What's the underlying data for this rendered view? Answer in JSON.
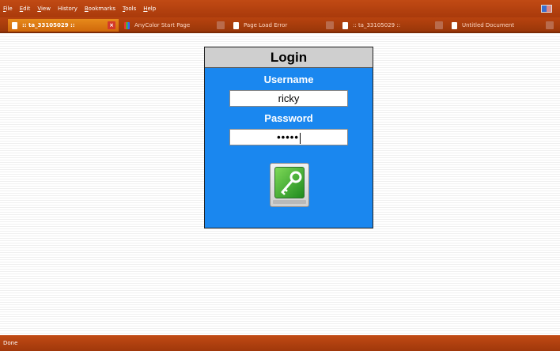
{
  "menu": {
    "items": [
      {
        "key": "F",
        "rest": "ile"
      },
      {
        "key": "E",
        "rest": "dit"
      },
      {
        "key": "V",
        "rest": "iew"
      },
      {
        "key": "",
        "rest": "History"
      },
      {
        "key": "B",
        "rest": "ookmarks"
      },
      {
        "key": "T",
        "rest": "ools"
      },
      {
        "key": "H",
        "rest": "elp"
      }
    ]
  },
  "tabs": [
    {
      "label": ":: ta_33105029 ::",
      "icon": "document-icon",
      "active": true
    },
    {
      "label": "AnyColor Start Page",
      "icon": "anycolor-icon",
      "active": false
    },
    {
      "label": "Page Load Error",
      "icon": "document-icon",
      "active": false
    },
    {
      "label": ":: ta_33105029 ::",
      "icon": "document-icon",
      "active": false
    },
    {
      "label": "Untitled Document",
      "icon": "document-icon",
      "active": false
    }
  ],
  "login": {
    "title": "Login",
    "username_label": "Username",
    "username_value": "ricky",
    "password_label": "Password",
    "password_value": "•••••",
    "button_icon": "key-icon"
  },
  "status": {
    "text": "Done"
  },
  "colors": {
    "chrome": "#b8430f",
    "panel": "#1a87ef",
    "title_bar": "#cfcfcf",
    "button_green": "#3aa53a"
  }
}
